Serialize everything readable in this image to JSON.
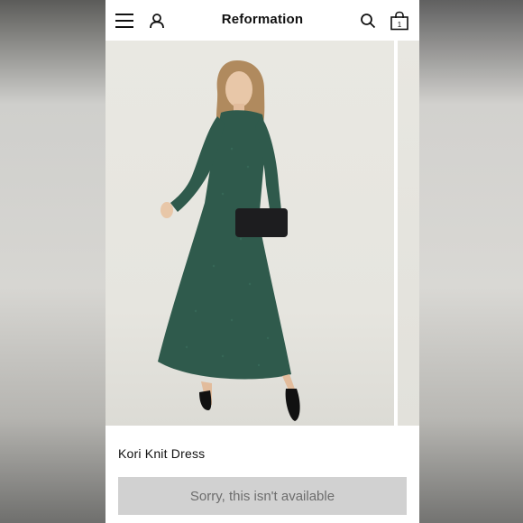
{
  "header": {
    "brand": "Reformation",
    "menu_icon": "hamburger-menu-icon",
    "account_icon": "user-icon",
    "search_icon": "search-icon",
    "bag_icon": "shopping-bag-icon",
    "bag_count": "1"
  },
  "product": {
    "name": "Kori Knit Dress",
    "availability_label": "Sorry, this isn't available",
    "dress_color": "#2f5a4c"
  },
  "colors": {
    "button_bg": "#d1d1d1",
    "button_text": "#6d6d6d"
  }
}
